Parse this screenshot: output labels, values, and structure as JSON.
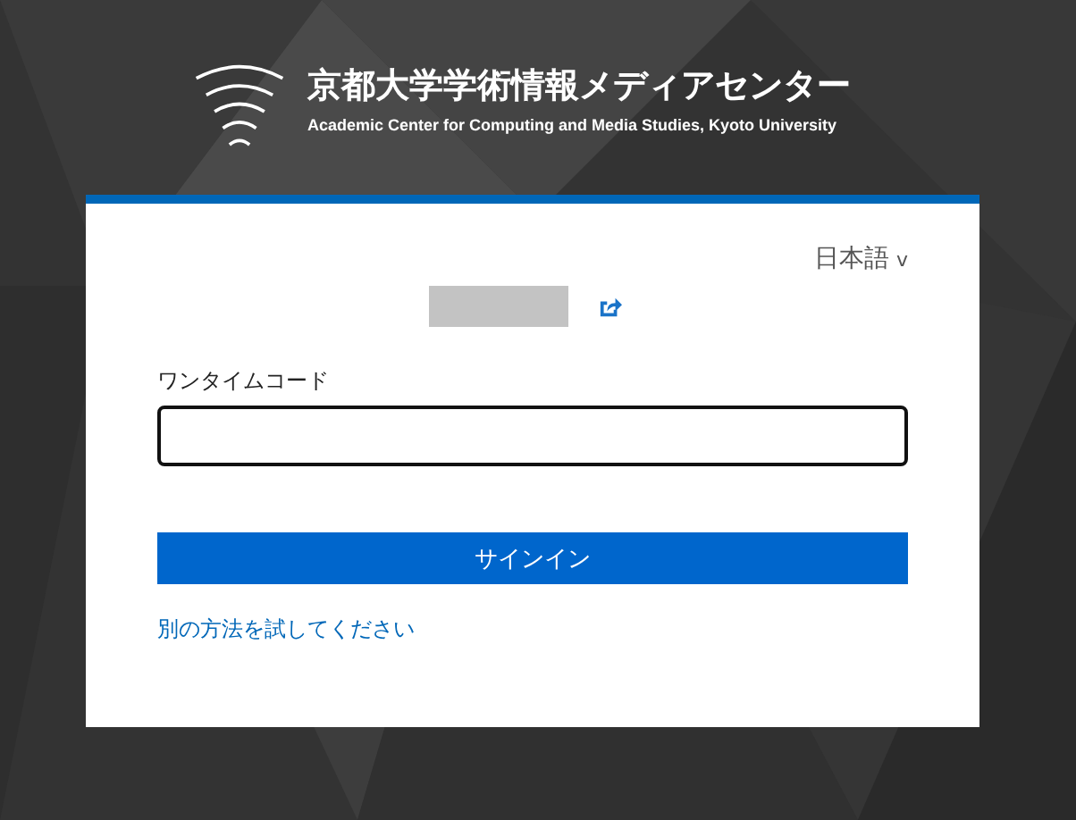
{
  "header": {
    "title": "京都大学学術情報メディアセンター",
    "subtitle": "Academic Center for Computing and Media Studies, Kyoto University"
  },
  "card": {
    "language": {
      "label": "日本語",
      "caret": "v"
    },
    "code_field": {
      "label": "ワンタイムコード"
    },
    "sign_in_button": "サインイン",
    "alternative_link": "別の方法を試してください"
  }
}
